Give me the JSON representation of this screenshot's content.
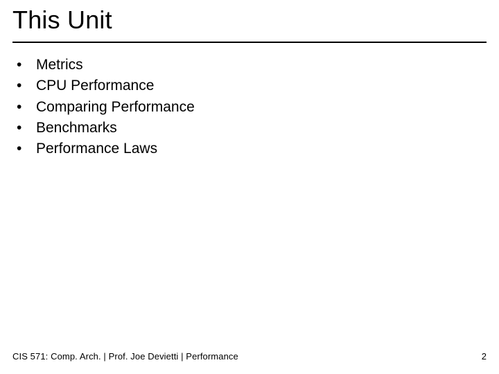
{
  "title": "This Unit",
  "bullets": [
    "Metrics",
    "CPU Performance",
    "Comparing Performance",
    "Benchmarks",
    "Performance Laws"
  ],
  "footer": {
    "left": "CIS 571: Comp. Arch.  |  Prof. Joe Devietti  |  Performance",
    "page": "2"
  }
}
